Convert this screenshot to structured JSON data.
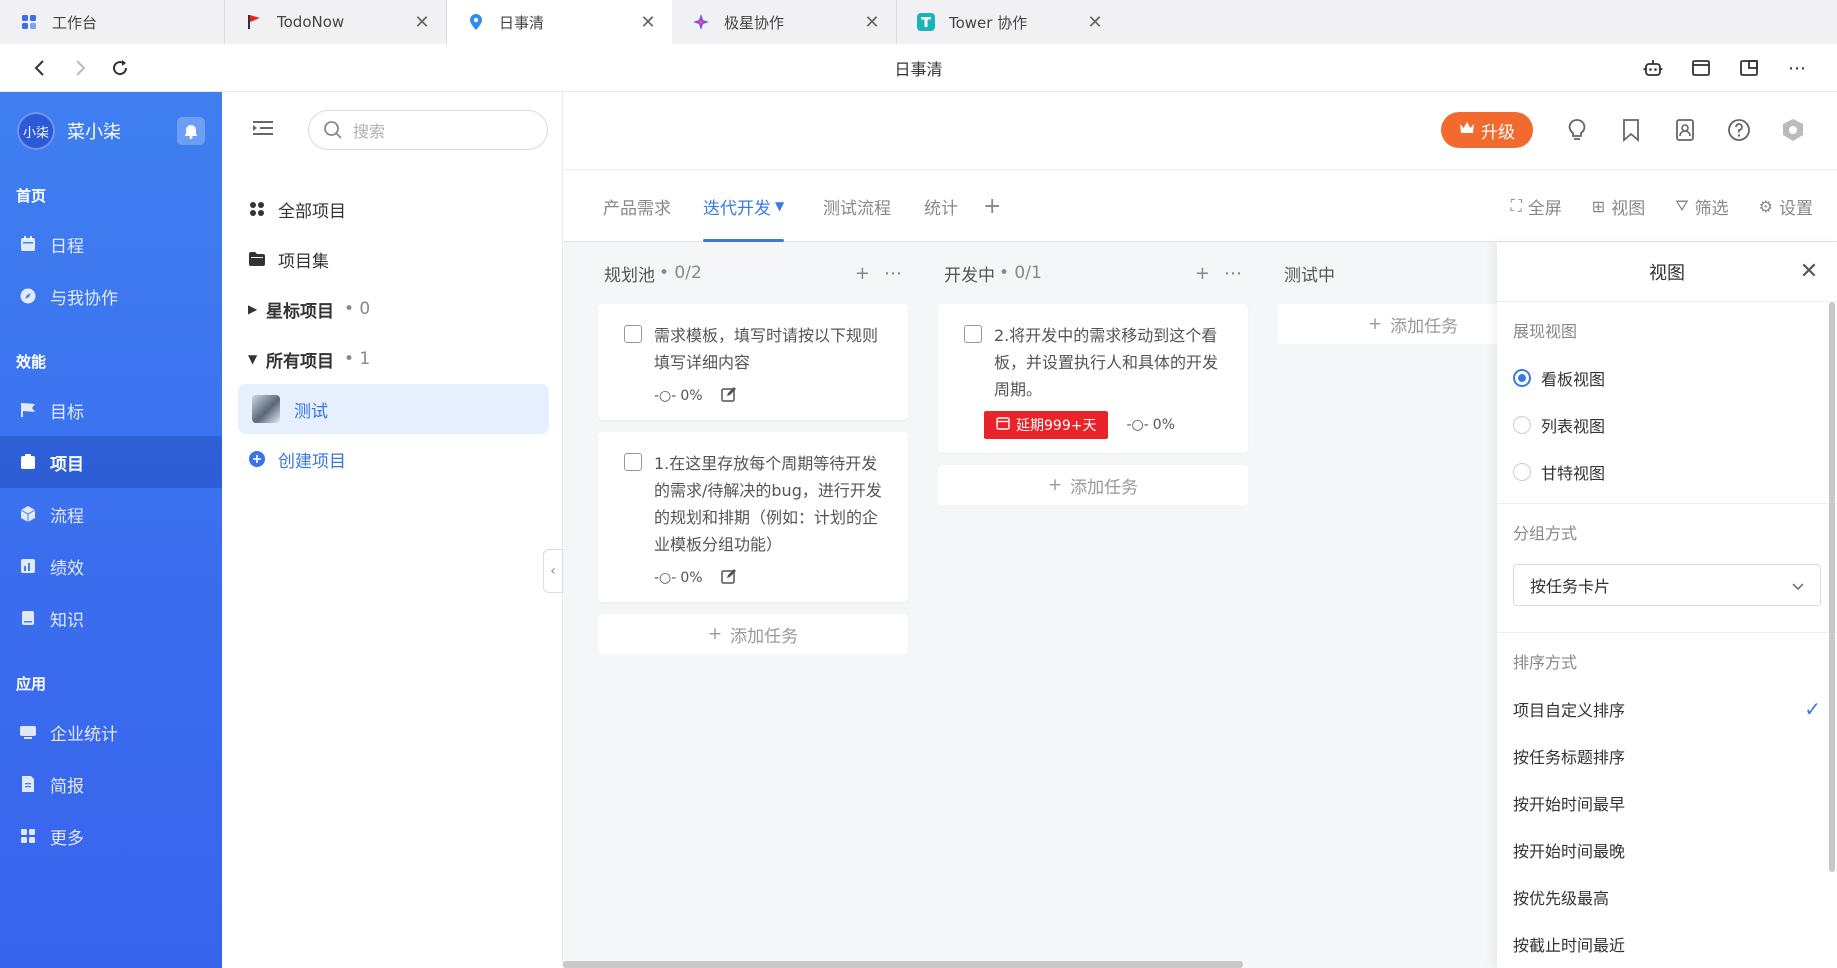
{
  "browser": {
    "tabs": [
      {
        "label": "工作台",
        "icon": "grid-icon"
      },
      {
        "label": "TodoNow",
        "icon": "flag-icon"
      },
      {
        "label": "日事清",
        "icon": "pin-icon"
      },
      {
        "label": "极星协作",
        "icon": "star-icon"
      },
      {
        "label": "Tower 协作",
        "icon": "tower-icon"
      }
    ],
    "active_tab": 2,
    "page_title": "日事清"
  },
  "sidebar": {
    "avatar_text": "小柒",
    "user_name": "菜小柒",
    "sections": [
      {
        "title": "首页",
        "items": [
          {
            "label": "日程",
            "icon": "calendar-icon"
          },
          {
            "label": "与我协作",
            "icon": "compass-icon"
          }
        ]
      },
      {
        "title": "效能",
        "items": [
          {
            "label": "目标",
            "icon": "flag-icon"
          },
          {
            "label": "项目",
            "icon": "project-icon"
          },
          {
            "label": "流程",
            "icon": "cube-icon"
          },
          {
            "label": "绩效",
            "icon": "chart-icon"
          },
          {
            "label": "知识",
            "icon": "book-icon"
          }
        ]
      },
      {
        "title": "应用",
        "items": [
          {
            "label": "企业统计",
            "icon": "stats-icon"
          },
          {
            "label": "简报",
            "icon": "report-icon"
          },
          {
            "label": "更多",
            "icon": "apps-icon"
          }
        ]
      }
    ],
    "active_item": "项目"
  },
  "project_panel": {
    "search_placeholder": "搜索",
    "items": [
      {
        "label": "全部项目"
      },
      {
        "label": "项目集"
      },
      {
        "label": "星标项目",
        "count": "• 0"
      },
      {
        "label": "所有项目",
        "count": "• 1"
      },
      {
        "label": "测试"
      },
      {
        "label": "创建项目"
      }
    ]
  },
  "header": {
    "upgrade_label": "升级"
  },
  "project_tabs": {
    "tabs": [
      "产品需求",
      "迭代开发",
      "测试流程",
      "统计"
    ],
    "active": "迭代开发",
    "tools": [
      "全屏",
      "视图",
      "筛选",
      "设置"
    ]
  },
  "kanban": {
    "columns": [
      {
        "title": "规划池",
        "count": "• 0/2",
        "cards": [
          {
            "text": "需求模板，填写时请按以下规则填写详细内容",
            "progress": "0%"
          },
          {
            "text": "1.在这里存放每个周期等待开发的需求/待解决的bug，进行开发的规划和排期（例如：计划的企业模板分组功能）",
            "progress": "0%"
          }
        ]
      },
      {
        "title": "开发中",
        "count": "• 0/1",
        "cards": [
          {
            "text": "2.将开发中的需求移动到这个看板，并设置执行人和具体的开发周期。",
            "overdue": "延期999+天",
            "progress": "0%"
          }
        ]
      },
      {
        "title": "测试中",
        "count": "",
        "cards": []
      }
    ],
    "add_task_label": "添加任务"
  },
  "view_drawer": {
    "title": "视图",
    "display_title": "展现视图",
    "views": [
      "看板视图",
      "列表视图",
      "甘特视图"
    ],
    "selected_view": "看板视图",
    "group_title": "分组方式",
    "group_value": "按任务卡片",
    "sort_title": "排序方式",
    "sorts": [
      "项目自定义排序",
      "按任务标题排序",
      "按开始时间最早",
      "按开始时间最晚",
      "按优先级最高",
      "按截止时间最近"
    ],
    "selected_sort": "项目自定义排序"
  },
  "colors": {
    "sidebar": "#3a6cee",
    "accent": "#3a7ae8",
    "upgrade": "#f26a2e",
    "overdue": "#e8242a"
  }
}
